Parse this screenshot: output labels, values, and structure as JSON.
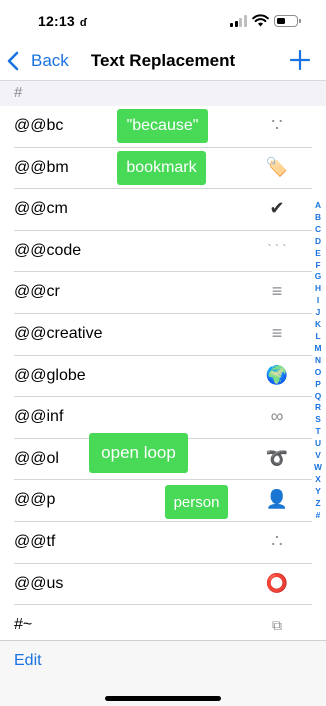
{
  "status_bar": {
    "time": "12:13",
    "focus_icon": "moon-icon",
    "focus_glyph": "ɗ"
  },
  "nav": {
    "back_label": "Back",
    "title": "Text Replacement",
    "add_icon": "plus-icon"
  },
  "section": {
    "header": "#"
  },
  "rows": [
    {
      "shortcut": "@@bc",
      "phrase": "∵"
    },
    {
      "shortcut": "@@bm",
      "phrase": "🏷️"
    },
    {
      "shortcut": "@@cm",
      "phrase": "✔"
    },
    {
      "shortcut": "@@code",
      "phrase": "` ` `"
    },
    {
      "shortcut": "@@cr",
      "phrase": "≡"
    },
    {
      "shortcut": "@@creative",
      "phrase": "≡"
    },
    {
      "shortcut": "@@globe",
      "phrase": "🌍"
    },
    {
      "shortcut": "@@inf",
      "phrase": "∞"
    },
    {
      "shortcut": "@@ol",
      "phrase": "➰"
    },
    {
      "shortcut": "@@p",
      "phrase": "👤"
    },
    {
      "shortcut": "@@tf",
      "phrase": "∴"
    },
    {
      "shortcut": "@@us",
      "phrase": "⭕"
    },
    {
      "shortcut": "#~",
      "phrase": "⧉"
    }
  ],
  "tooltips": [
    {
      "label": "\"because\""
    },
    {
      "label": "bookmark"
    },
    {
      "label": "open loop"
    },
    {
      "label": "person"
    }
  ],
  "index_letters": [
    "A",
    "B",
    "C",
    "D",
    "E",
    "F",
    "G",
    "H",
    "I",
    "J",
    "K",
    "L",
    "M",
    "N",
    "O",
    "P",
    "Q",
    "R",
    "S",
    "T",
    "U",
    "V",
    "W",
    "X",
    "Y",
    "Z",
    "#"
  ],
  "toolbar": {
    "edit_label": "Edit"
  },
  "colors": {
    "accent": "#1a73e0",
    "tooltip_green": "#48d957",
    "section_bg": "#f2f2f7"
  }
}
